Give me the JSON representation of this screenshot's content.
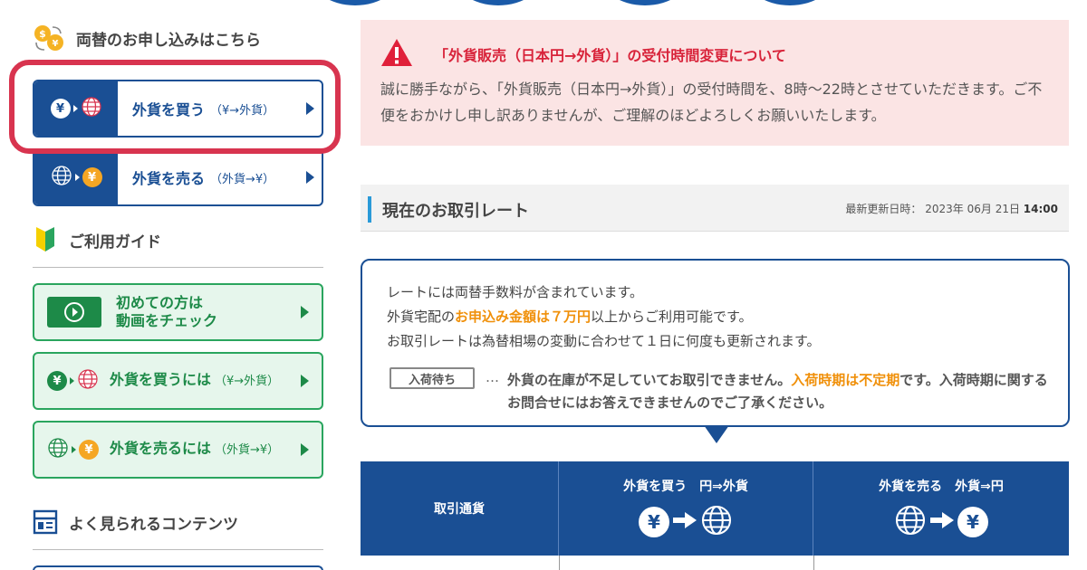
{
  "sidebar": {
    "exchange_title": "両替のお申し込みはこちら",
    "buy": {
      "label": "外貨を買う",
      "sub": "（¥→外貨）"
    },
    "sell": {
      "label": "外貨を売る",
      "sub": "（外貨→¥）"
    },
    "guide_title": "ご利用ガイド",
    "guide_items": [
      {
        "label_line1": "初めての方は",
        "label_line2": "動画をチェック"
      },
      {
        "label": "外貨を買うには",
        "sub": "（¥→外貨）"
      },
      {
        "label": "外貨を売るには",
        "sub": "（外貨→¥）"
      }
    ],
    "popular_title": "よく見られるコンテンツ"
  },
  "alert": {
    "title": "「外貨販売（日本円→外貨）」の受付時間変更について",
    "body": "誠に勝手ながら、「外貨販売（日本円→外貨）」の受付時間を、8時～22時とさせていただきます。ご不便をおかけし申し訳ありませんが、ご理解のほどよろしくお願いいたします。"
  },
  "rates": {
    "title": "現在のお取引レート",
    "updated_label": "最新更新日時：",
    "updated_date": "2023年 06月 21日",
    "updated_time": "14:00"
  },
  "notice": {
    "line1": "レートには両替手数料が含まれています。",
    "line2_pre": "外貨宅配の",
    "line2_emph": "お申込み金額は７万円",
    "line2_post": "以上からご利用可能です。",
    "line3": "お取引レートは為替相場の変動に合わせて１日に何度も更新されます。",
    "tag": "入荷待ち",
    "dots": "…",
    "wait_pre": "外貨の在庫が不足していてお取引できません。",
    "wait_emph": "入荷時期は不定期",
    "wait_post": "です。入荷時期に関するお問合せにはお答えできませんのでご了承ください。"
  },
  "table": {
    "col1": "取引通貨",
    "col2": "外貨を買う　円⇒外貨",
    "col3": "外貨を売る　外貨⇒円"
  },
  "icons": {
    "yen": "¥"
  },
  "colors": {
    "brand_blue": "#1a4f94",
    "green": "#2aa55e",
    "alert_red": "#d8233a",
    "orange": "#f0900a",
    "highlight": "#d8344f"
  }
}
